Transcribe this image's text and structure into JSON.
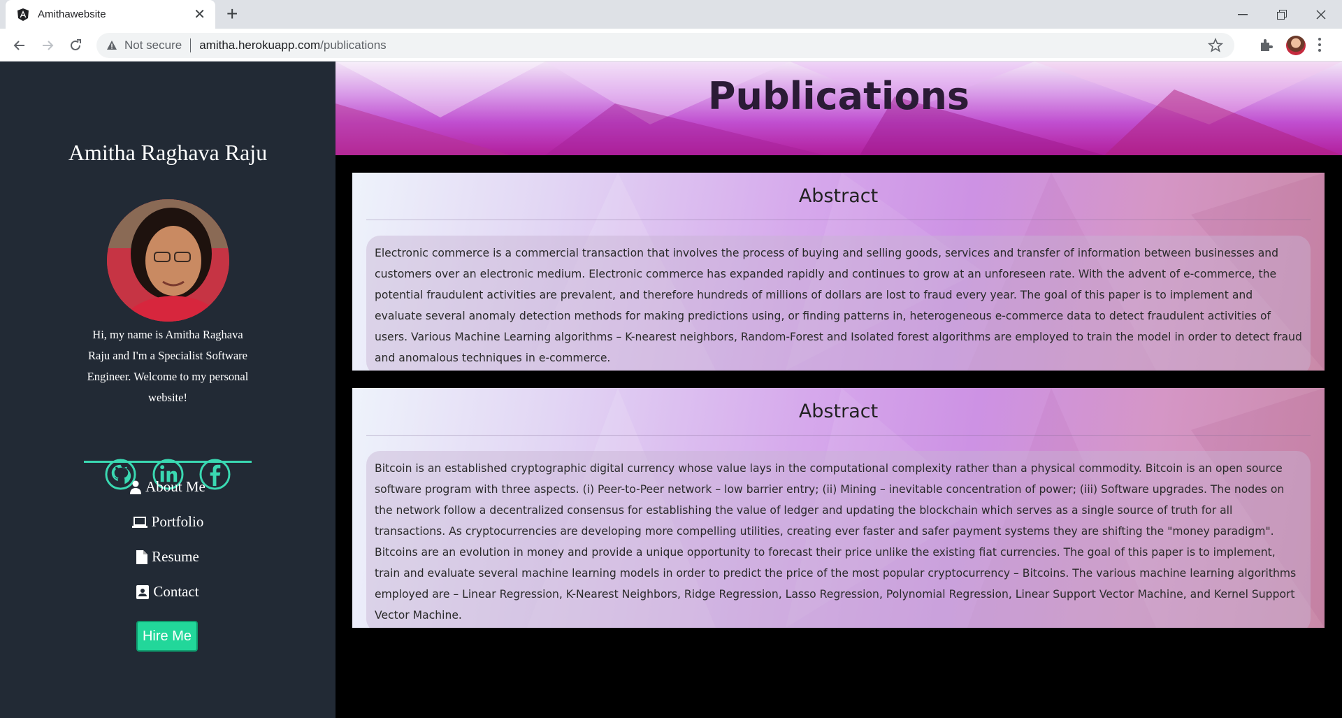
{
  "browser": {
    "tab_title": "Amithawebsite",
    "security_label": "Not secure",
    "url_host": "amitha.herokuapp.com",
    "url_path": "/publications"
  },
  "sidebar": {
    "name": "Amitha Raghava Raju",
    "intro": "Hi, my name is Amitha Raghava Raju and I'm a Specialist Software Engineer. Welcome to my personal website!",
    "socials": [
      "github-icon",
      "linkedin-icon",
      "facebook-icon"
    ],
    "nav": [
      {
        "label": "About Me",
        "icon": "user-icon"
      },
      {
        "label": "Portfolio",
        "icon": "laptop-icon"
      },
      {
        "label": "Resume",
        "icon": "file-icon"
      },
      {
        "label": "Contact",
        "icon": "contact-card-icon"
      }
    ],
    "hire_label": "Hire Me",
    "accent": "#3ad9b2",
    "hire_color": "#22d79a"
  },
  "main": {
    "page_title": "Publications",
    "cards": [
      {
        "title": "Abstract",
        "text": "Electronic commerce is a commercial transaction that involves the process of buying and selling goods, services and transfer of information between businesses and customers over an electronic medium. Electronic commerce has expanded rapidly and continues to grow at an unforeseen rate. With the advent of e-commerce, the potential fraudulent activities are prevalent, and therefore hundreds of millions of dollars are lost to fraud every year. The goal of this paper is to implement and evaluate several anomaly detection methods for making predictions using, or finding patterns in, heterogeneous e-commerce data to detect fraudulent activities of users. Various Machine Learning algorithms – K-nearest neighbors, Random-Forest and Isolated forest algorithms are employed to train the model in order to detect fraud and anomalous techniques in e-commerce."
      },
      {
        "title": "Abstract",
        "text": "Bitcoin is an established cryptographic digital currency whose value lays in the computational complexity rather than a physical commodity. Bitcoin is an open source software program with three aspects. (i) Peer-to-Peer network – low barrier entry; (ii) Mining – inevitable concentration of power; (iii) Software upgrades. The nodes on the network follow a decentralized consensus for establishing the value of ledger and updating the blockchain which serves as a single source of truth for all transactions. As cryptocurrencies are developing more compelling utilities, creating ever faster and safer payment systems they are shifting the \"money paradigm\". Bitcoins are an evolution in money and provide a unique opportunity to forecast their price unlike the existing fiat currencies. The goal of this paper is to implement, train and evaluate several machine learning models in order to predict the price of the most popular cryptocurrency – Bitcoins. The various machine learning algorithms employed are – Linear Regression, K-Nearest Neighbors, Ridge Regression, Lasso Regression, Polynomial Regression, Linear Support Vector Machine, and Kernel Support Vector Machine."
      }
    ]
  }
}
